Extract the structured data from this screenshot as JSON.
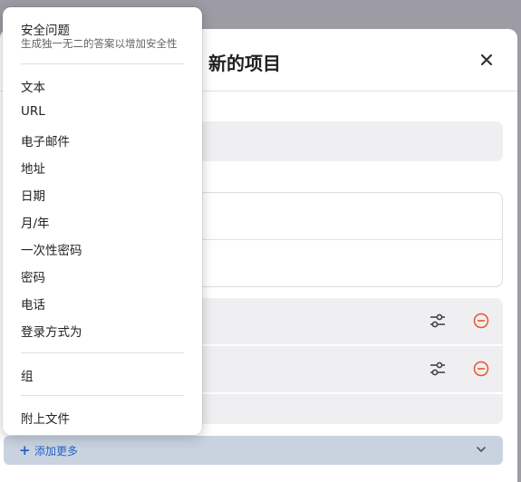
{
  "dialog": {
    "title": "新的项目",
    "close_icon": "close-icon"
  },
  "menu": {
    "header": {
      "title": "安全问题",
      "subtitle": "生成独一无二的答案以增加安全性"
    },
    "items": [
      {
        "label": "文本"
      },
      {
        "label": "URL"
      },
      {
        "label": "电子邮件"
      },
      {
        "label": "地址"
      },
      {
        "label": "日期"
      },
      {
        "label": "月/年"
      },
      {
        "label": "一次性密码"
      },
      {
        "label": "密码"
      },
      {
        "label": "电话"
      },
      {
        "label": "登录方式为"
      }
    ],
    "group": {
      "label": "组"
    },
    "attach": {
      "label": "附上文件"
    }
  },
  "add_more": {
    "label": "添加更多",
    "icon": "plus-icon",
    "chevron": "chevron-down-icon"
  },
  "colors": {
    "accent": "#2563c9",
    "remove": "#e8552b",
    "backdrop": "#9d9ca4"
  }
}
